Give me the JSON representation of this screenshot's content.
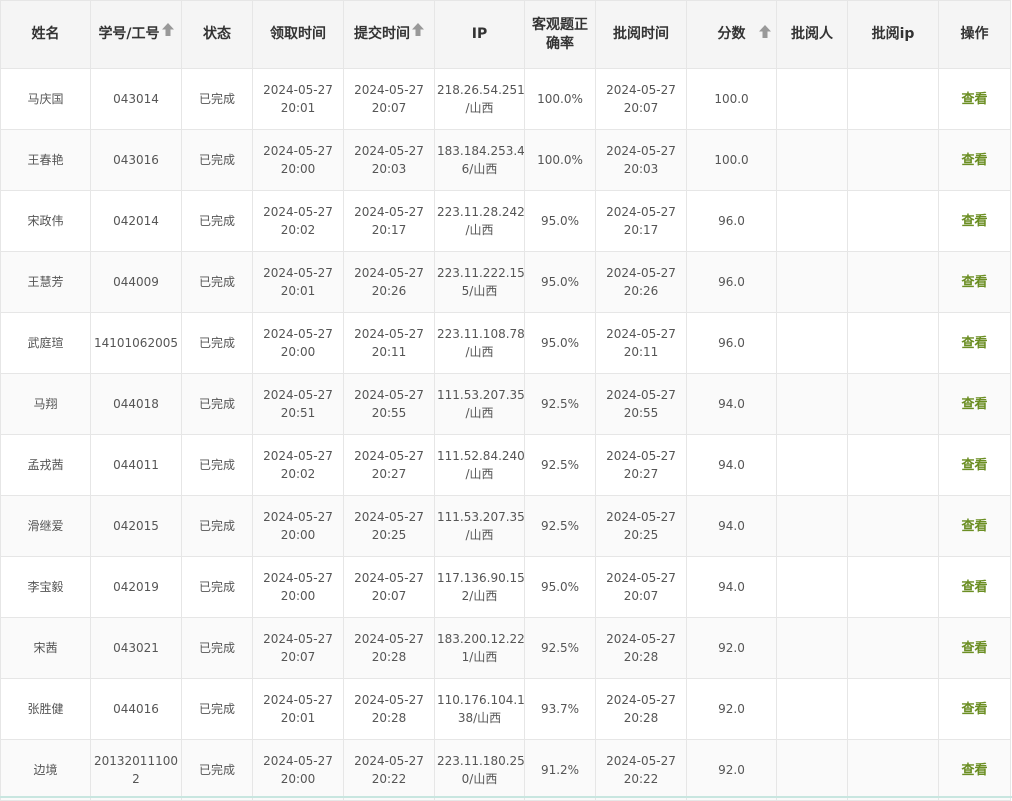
{
  "headers": {
    "name": "姓名",
    "id": "学号/工号",
    "status": "状态",
    "receive_time": "领取时间",
    "submit_time": "提交时间",
    "ip": "IP",
    "objective_accuracy": "客观题正确率",
    "review_time": "批阅时间",
    "score": "分数",
    "reviewer": "批阅人",
    "reviewer_ip": "批阅ip",
    "action": "操作"
  },
  "icons": {
    "sort": "sort-up-arrow-icon"
  },
  "colors": {
    "link": "#6b8e23",
    "header_bg": "#f5f5f5",
    "border": "#e6e6e6"
  },
  "rows": [
    {
      "name": "马庆国",
      "id": "043014",
      "status": "已完成",
      "receive_date": "2024-05-27",
      "receive_clock": "20:01",
      "submit_date": "2024-05-27",
      "submit_clock": "20:07",
      "ip_line1": "218.26.54.251",
      "ip_line2": "/山西",
      "accuracy": "100.0%",
      "review_date": "2024-05-27",
      "review_clock": "20:07",
      "score": "100.0",
      "reviewer": "",
      "reviewer_ip": "",
      "action": "查看"
    },
    {
      "name": "王春艳",
      "id": "043016",
      "status": "已完成",
      "receive_date": "2024-05-27",
      "receive_clock": "20:00",
      "submit_date": "2024-05-27",
      "submit_clock": "20:03",
      "ip_line1": "183.184.253.4",
      "ip_line2": "6/山西",
      "accuracy": "100.0%",
      "review_date": "2024-05-27",
      "review_clock": "20:03",
      "score": "100.0",
      "reviewer": "",
      "reviewer_ip": "",
      "action": "查看"
    },
    {
      "name": "宋政伟",
      "id": "042014",
      "status": "已完成",
      "receive_date": "2024-05-27",
      "receive_clock": "20:02",
      "submit_date": "2024-05-27",
      "submit_clock": "20:17",
      "ip_line1": "223.11.28.242",
      "ip_line2": "/山西",
      "accuracy": "95.0%",
      "review_date": "2024-05-27",
      "review_clock": "20:17",
      "score": "96.0",
      "reviewer": "",
      "reviewer_ip": "",
      "action": "查看"
    },
    {
      "name": "王慧芳",
      "id": "044009",
      "status": "已完成",
      "receive_date": "2024-05-27",
      "receive_clock": "20:01",
      "submit_date": "2024-05-27",
      "submit_clock": "20:26",
      "ip_line1": "223.11.222.15",
      "ip_line2": "5/山西",
      "accuracy": "95.0%",
      "review_date": "2024-05-27",
      "review_clock": "20:26",
      "score": "96.0",
      "reviewer": "",
      "reviewer_ip": "",
      "action": "查看"
    },
    {
      "name": "武庭瑄",
      "id": "14101062005",
      "status": "已完成",
      "receive_date": "2024-05-27",
      "receive_clock": "20:00",
      "submit_date": "2024-05-27",
      "submit_clock": "20:11",
      "ip_line1": "223.11.108.78",
      "ip_line2": "/山西",
      "accuracy": "95.0%",
      "review_date": "2024-05-27",
      "review_clock": "20:11",
      "score": "96.0",
      "reviewer": "",
      "reviewer_ip": "",
      "action": "查看"
    },
    {
      "name": "马翔",
      "id": "044018",
      "status": "已完成",
      "receive_date": "2024-05-27",
      "receive_clock": "20:51",
      "submit_date": "2024-05-27",
      "submit_clock": "20:55",
      "ip_line1": "111.53.207.35",
      "ip_line2": "/山西",
      "accuracy": "92.5%",
      "review_date": "2024-05-27",
      "review_clock": "20:55",
      "score": "94.0",
      "reviewer": "",
      "reviewer_ip": "",
      "action": "查看"
    },
    {
      "name": "孟戎茜",
      "id": "044011",
      "status": "已完成",
      "receive_date": "2024-05-27",
      "receive_clock": "20:02",
      "submit_date": "2024-05-27",
      "submit_clock": "20:27",
      "ip_line1": "111.52.84.240",
      "ip_line2": "/山西",
      "accuracy": "92.5%",
      "review_date": "2024-05-27",
      "review_clock": "20:27",
      "score": "94.0",
      "reviewer": "",
      "reviewer_ip": "",
      "action": "查看"
    },
    {
      "name": "滑继爱",
      "id": "042015",
      "status": "已完成",
      "receive_date": "2024-05-27",
      "receive_clock": "20:00",
      "submit_date": "2024-05-27",
      "submit_clock": "20:25",
      "ip_line1": "111.53.207.35",
      "ip_line2": "/山西",
      "accuracy": "92.5%",
      "review_date": "2024-05-27",
      "review_clock": "20:25",
      "score": "94.0",
      "reviewer": "",
      "reviewer_ip": "",
      "action": "查看"
    },
    {
      "name": "李宝毅",
      "id": "042019",
      "status": "已完成",
      "receive_date": "2024-05-27",
      "receive_clock": "20:00",
      "submit_date": "2024-05-27",
      "submit_clock": "20:07",
      "ip_line1": "117.136.90.15",
      "ip_line2": "2/山西",
      "accuracy": "95.0%",
      "review_date": "2024-05-27",
      "review_clock": "20:07",
      "score": "94.0",
      "reviewer": "",
      "reviewer_ip": "",
      "action": "查看"
    },
    {
      "name": "宋茜",
      "id": "043021",
      "status": "已完成",
      "receive_date": "2024-05-27",
      "receive_clock": "20:07",
      "submit_date": "2024-05-27",
      "submit_clock": "20:28",
      "ip_line1": "183.200.12.22",
      "ip_line2": "1/山西",
      "accuracy": "92.5%",
      "review_date": "2024-05-27",
      "review_clock": "20:28",
      "score": "92.0",
      "reviewer": "",
      "reviewer_ip": "",
      "action": "查看"
    },
    {
      "name": "张胜健",
      "id": "044016",
      "status": "已完成",
      "receive_date": "2024-05-27",
      "receive_clock": "20:01",
      "submit_date": "2024-05-27",
      "submit_clock": "20:28",
      "ip_line1": "110.176.104.1",
      "ip_line2": "38/山西",
      "accuracy": "93.7%",
      "review_date": "2024-05-27",
      "review_clock": "20:28",
      "score": "92.0",
      "reviewer": "",
      "reviewer_ip": "",
      "action": "查看"
    },
    {
      "name": "边境",
      "id": "201320111002",
      "status": "已完成",
      "receive_date": "2024-05-27",
      "receive_clock": "20:00",
      "submit_date": "2024-05-27",
      "submit_clock": "20:22",
      "ip_line1": "223.11.180.25",
      "ip_line2": "0/山西",
      "accuracy": "91.2%",
      "review_date": "2024-05-27",
      "review_clock": "20:22",
      "score": "92.0",
      "reviewer": "",
      "reviewer_ip": "",
      "action": "查看"
    }
  ]
}
